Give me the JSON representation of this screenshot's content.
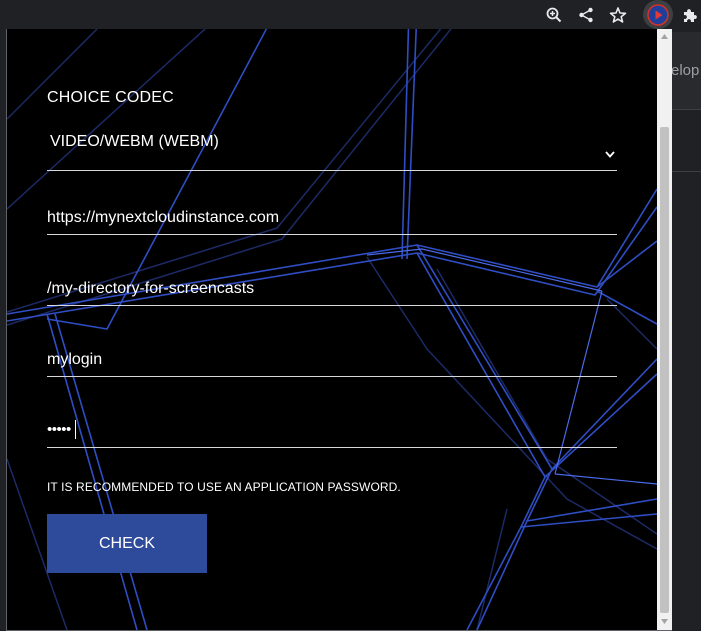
{
  "toolbar": {
    "icons": [
      "zoom-icon",
      "share-icon",
      "bookmark-star-icon",
      "extension-play-icon",
      "extensions-puzzle-icon"
    ]
  },
  "background_page": {
    "partial_text": "elop"
  },
  "form": {
    "codec_label": "CHOICE CODEC",
    "codec_value": "VIDEO/WEBM (WEBM)",
    "url_value": "https://mynextcloudinstance.com",
    "directory_value": "/my-directory-for-screencasts",
    "login_value": "mylogin",
    "password_masked": "•••••",
    "hint": "IT IS RECOMMENDED TO USE AN APPLICATION PASSWORD.",
    "check_label": "CHECK"
  },
  "colors": {
    "accent": "#2e4b9b",
    "lines": "#3a5bd1",
    "background": "#000000"
  }
}
